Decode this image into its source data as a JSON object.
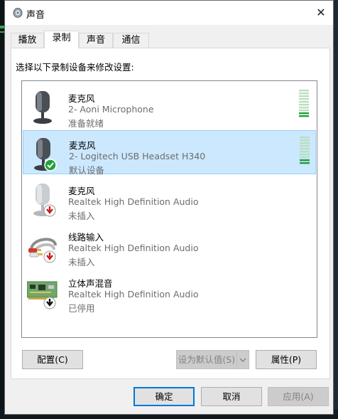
{
  "window": {
    "title": "声音",
    "close_glyph": "✕"
  },
  "tabs": [
    {
      "label": "播放"
    },
    {
      "label": "录制",
      "active": true
    },
    {
      "label": "声音"
    },
    {
      "label": "通信"
    }
  ],
  "prompt": "选择以下录制设备来修改设置:",
  "devices": [
    {
      "name": "麦克风",
      "description": "2- Aoni Microphone",
      "status": "准备就绪",
      "icon": "microphone-icon",
      "badge": "none",
      "selected": false,
      "level_bars_active": 2
    },
    {
      "name": "麦克风",
      "description": "2- Logitech USB Headset H340",
      "status": "默认设备",
      "icon": "microphone-icon",
      "badge": "default-check-badge",
      "selected": true,
      "level_bars_active": 2
    },
    {
      "name": "麦克风",
      "description": "Realtek High Definition Audio",
      "status": "未插入",
      "icon": "microphone-icon",
      "badge": "unplugged-red-arrow-badge",
      "selected": false
    },
    {
      "name": "线路输入",
      "description": "Realtek High Definition Audio",
      "status": "未插入",
      "icon": "rca-cable-icon",
      "badge": "unplugged-red-arrow-badge",
      "selected": false
    },
    {
      "name": "立体声混音",
      "description": "Realtek High Definition Audio",
      "status": "已停用",
      "icon": "sound-card-icon",
      "badge": "disabled-black-arrow-badge",
      "selected": false
    }
  ],
  "buttons": {
    "configure": "配置(C)",
    "set_default": "设为默认值(S)",
    "properties": "属性(P)",
    "ok": "确定",
    "cancel": "取消",
    "apply": "应用(A)"
  },
  "colors": {
    "selection_bg": "#cce8ff",
    "selection_border": "#99d1ff",
    "meter_active": "#1e9e3a",
    "meter_idle": "#b9dfbf",
    "accent": "#0078d7"
  }
}
